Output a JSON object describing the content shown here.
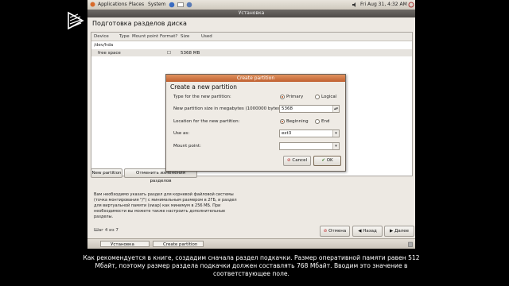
{
  "top_panel": {
    "applications": "Applications",
    "places": "Places",
    "system": "System",
    "datetime": "Fri Aug 31,  4:32 AM"
  },
  "window": {
    "title": "Установка",
    "heading": "Подготовка разделов диска"
  },
  "table": {
    "headers": [
      "Device",
      "Type",
      "Mount point",
      "Format?",
      "Size",
      "Used"
    ],
    "rows": [
      {
        "device": "/dev/hda",
        "type": "",
        "mount": "",
        "format": "",
        "size": "",
        "used": ""
      },
      {
        "device": "free space",
        "type": "",
        "mount": "",
        "format": "☐",
        "size": "5368 MB",
        "used": ""
      }
    ]
  },
  "buttons": {
    "new_partition": "New partition",
    "undo_changes": "Отменить изменения разделов",
    "cancel": "Отмена",
    "back": "Назад",
    "forward": "Далее"
  },
  "info_text": "Вам необходимо указать раздел для корневой файловой системы (точка монтирования \"/\") с минимальным размером в 2ГБ, и раздел для виртуальной памяти (swap) как минимум в 256 МБ. При необходимости вы можете также настроить дополнительные разделы.",
  "step": "Шаг 4 из 7",
  "taskbar": {
    "task1": "Установка",
    "task2": "Create partition"
  },
  "dialog": {
    "title": "Create partition",
    "heading": "Create a new partition",
    "type_label": "Type for the new partition:",
    "type_options": [
      "Primary",
      "Logical"
    ],
    "type_selected": "Primary",
    "size_label": "New partition size in megabytes (1000000 bytes):",
    "size_value": "5368",
    "location_label": "Location for the new partition:",
    "location_options": [
      "Beginning",
      "End"
    ],
    "location_selected": "Beginning",
    "use_as_label": "Use as:",
    "use_as_value": "ext3",
    "mount_label": "Mount point:",
    "mount_value": "",
    "cancel": "Cancel",
    "ok": "OK"
  },
  "caption": "Как рекомендуется в книге, создадим сначала раздел подкачки. Размер оперативной памяти равен 512 Мбайт, поэтому размер раздела подкачки должен составлять 768 Мбайт. Вводим это значение в соответствующее поле.",
  "colors": {
    "dialog_titlebar": "#c8683a",
    "window_bg": "#ede9e3",
    "video_bg": "#000000"
  }
}
